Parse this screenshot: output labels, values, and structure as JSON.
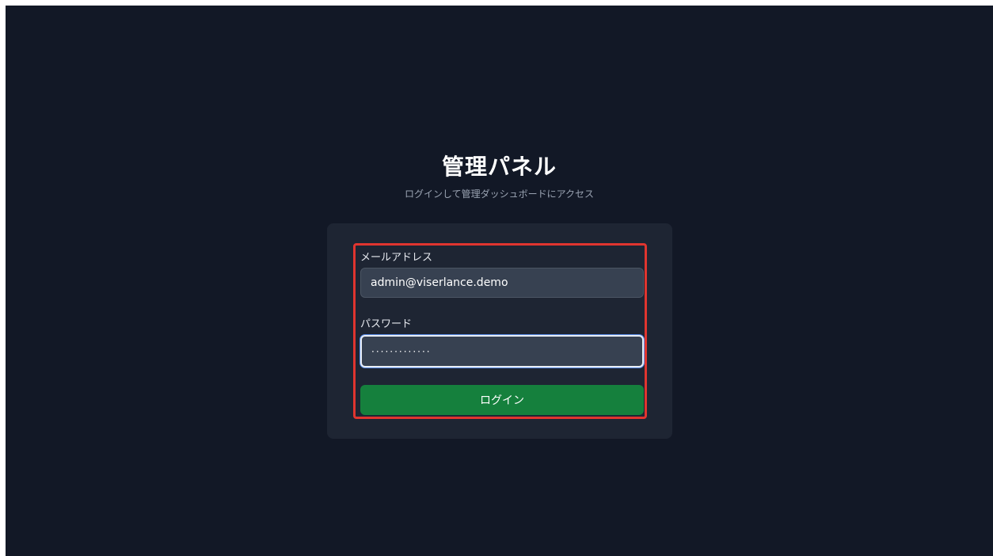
{
  "header": {
    "title": "管理パネル",
    "subtitle": "ログインして管理ダッシュボードにアクセス"
  },
  "form": {
    "email_label": "メールアドレス",
    "email_value": "admin@viserlance.demo",
    "password_label": "パスワード",
    "password_masked": "·············",
    "login_label": "ログイン"
  },
  "colors": {
    "background": "#121826",
    "card": "#1e2533",
    "input": "#374151",
    "button": "#15803d",
    "highlight": "#e0352f"
  }
}
